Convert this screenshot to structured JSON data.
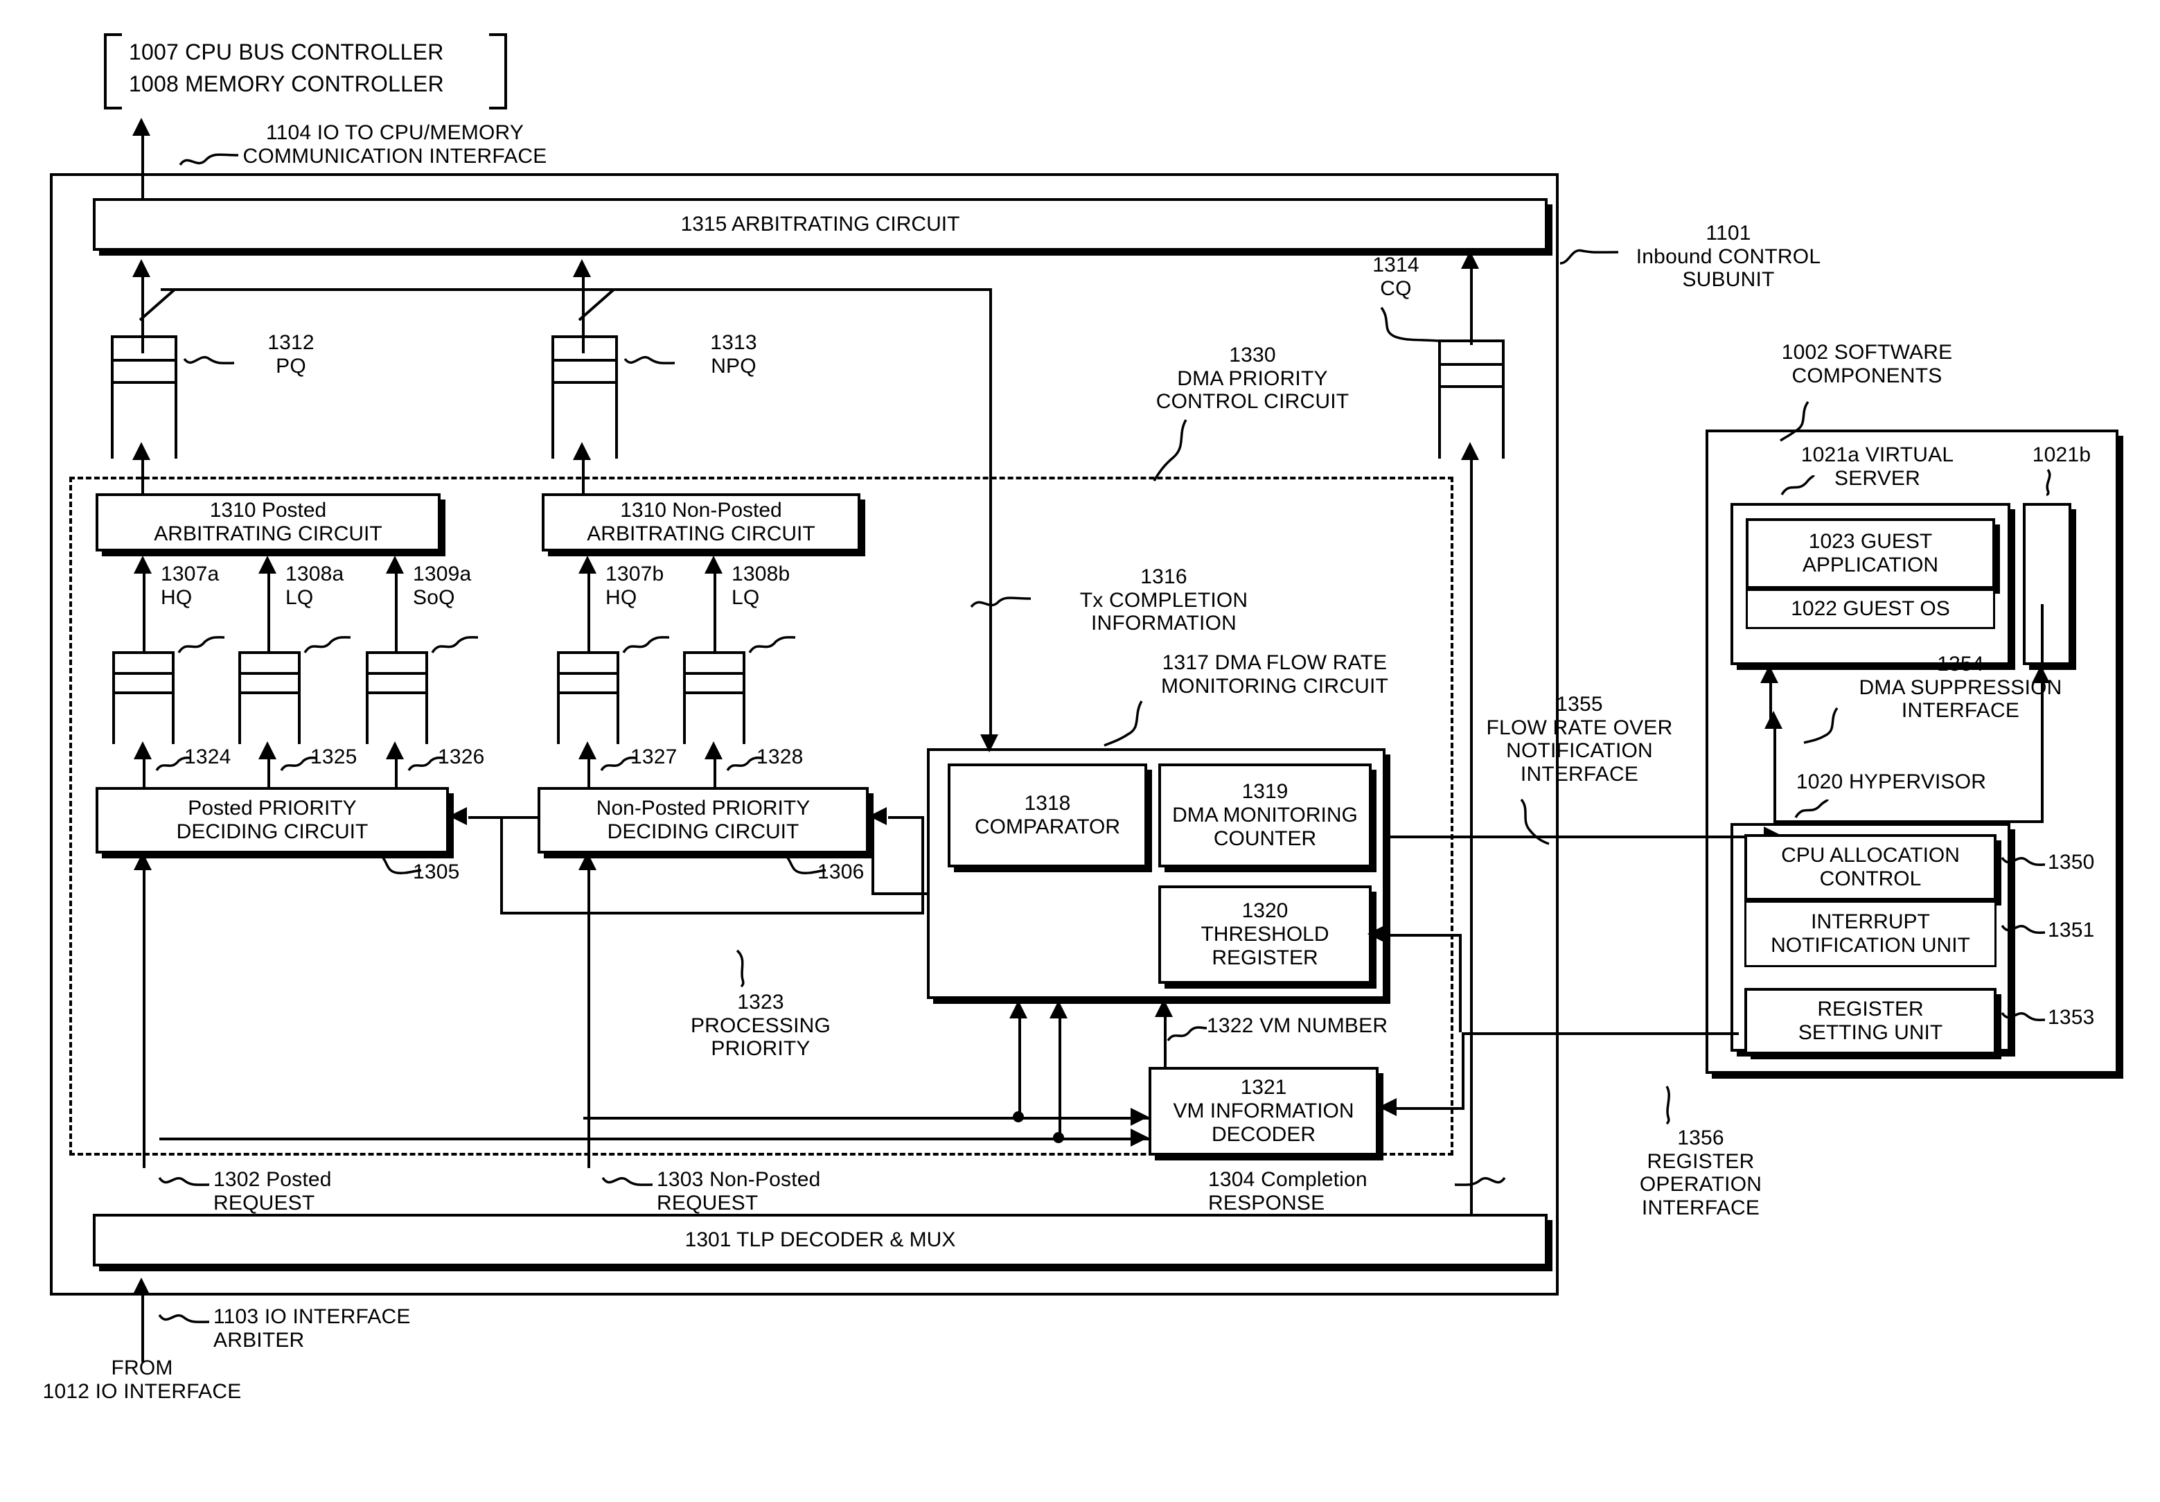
{
  "figure": {
    "top_callout": {
      "line1": "1007 CPU BUS CONTROLLER",
      "line2": "1008 MEMORY CONTROLLER"
    },
    "interfaces": {
      "io_to_cpu_memory": "1104 IO TO CPU/MEMORY\nCOMMUNICATION INTERFACE",
      "io_interface_arbiter": "1103 IO INTERFACE\nARBITER",
      "dma_suppression": "1354\nDMA SUPPRESSION\nINTERFACE",
      "flow_rate_over_notification": "1355\nFLOW RATE OVER\nNOTIFICATION\nINTERFACE",
      "register_operation": "1356\nREGISTER\nOPERATION\nINTERFACE"
    },
    "source_label": "FROM\n1012 IO INTERFACE",
    "inbound_subunit": "1101\nInbound CONTROL\nSUBUNIT",
    "software_components": "1002 SOFTWARE\nCOMPONENTS",
    "arbitrating_circuit": "1315 ARBITRATING CIRCUIT",
    "tlp_decoder": "1301 TLP DECODER & MUX",
    "queues": {
      "pq": "1312\nPQ",
      "npq": "1313\nNPQ",
      "cq": "1314\nCQ",
      "posted_hq": "1307a\nHQ",
      "posted_lq": "1308a\nLQ",
      "posted_soq": "1309a\nSoQ",
      "nonposted_hq": "1307b\nHQ",
      "nonposted_lq": "1308b\nLQ"
    },
    "posted_arbitrating": "1310 Posted\nARBITRATING CIRCUIT",
    "nonposted_arbitrating": "1310 Non-Posted\nARBITRATING CIRCUIT",
    "posted_priority": "Posted PRIORITY\nDECIDING CIRCUIT",
    "posted_priority_ref": "1305",
    "nonposted_priority": "Non-Posted PRIORITY\nDECIDING CIRCUIT",
    "nonposted_priority_ref": "1306",
    "signal_refs": {
      "s1324": "1324",
      "s1325": "1325",
      "s1326": "1326",
      "s1327": "1327",
      "s1328": "1328"
    },
    "dma_priority_control": "1330\nDMA PRIORITY\nCONTROL CIRCUIT",
    "tx_completion_information": "1316\nTx COMPLETION\nINFORMATION",
    "dma_flow_rate_monitoring": "1317 DMA FLOW RATE\nMONITORING CIRCUIT",
    "comparator": "1318\nCOMPARATOR",
    "dma_monitoring_counter": "1319\nDMA MONITORING\nCOUNTER",
    "threshold_register": "1320\nTHRESHOLD\nREGISTER",
    "vm_information_decoder": "1321\nVM INFORMATION\nDECODER",
    "vm_number": "1322 VM NUMBER",
    "processing_priority": "1323\nPROCESSING\nPRIORITY",
    "posted_request": "1302 Posted\nREQUEST",
    "nonposted_request": "1303 Non-Posted\nREQUEST",
    "completion_response": "1304 Completion\nRESPONSE",
    "virtual_server": "1021a VIRTUAL\nSERVER",
    "virtual_server_b": "1021b",
    "guest_application": "1023 GUEST\nAPPLICATION",
    "guest_os": "1022 GUEST OS",
    "hypervisor": "1020 HYPERVISOR",
    "cpu_allocation_control": "CPU ALLOCATION\nCONTROL",
    "cpu_allocation_control_ref": "1350",
    "interrupt_notification_unit": "INTERRUPT\nNOTIFICATION UNIT",
    "interrupt_notification_unit_ref": "1351",
    "register_setting_unit": "REGISTER\nSETTING UNIT",
    "register_setting_unit_ref": "1353"
  },
  "colors": {
    "ink": "#000000",
    "paper": "#ffffff"
  }
}
